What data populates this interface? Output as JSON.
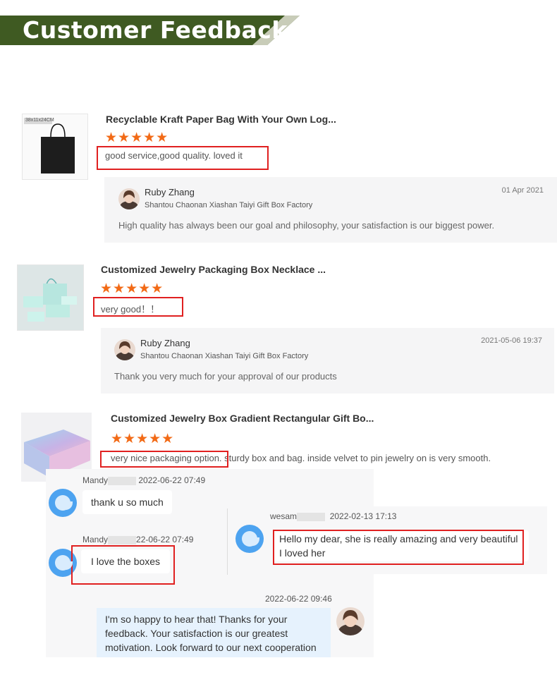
{
  "header": {
    "title": "Customer Feedback"
  },
  "reviews": [
    {
      "product_title": "Recyclable Kraft Paper Bag With Your Own Log...",
      "thumb_label": "38x11x24CM",
      "stars": "★★★★★",
      "rating": 5,
      "text": "good service,good quality. loved it",
      "reply": {
        "name": "Ruby Zhang",
        "company": "Shantou Chaonan Xiashan Taiyi Gift Box Factory",
        "date": "01 Apr 2021",
        "message": "High quality has always been our goal and philosophy, your satisfaction is our biggest power."
      }
    },
    {
      "product_title": "Customized Jewelry Packaging Box Necklace ...",
      "stars": "★★★★★",
      "rating": 5,
      "text": "very good！！",
      "reply": {
        "name": "Ruby Zhang",
        "company": "Shantou Chaonan Xiashan Taiyi Gift Box Factory",
        "date": "2021-05-06 19:37",
        "message": "Thank you very much for your approval of our products"
      }
    },
    {
      "product_title": "Customized Jewelry Box Gradient Rectangular Gift Bo...",
      "stars": "★★★★★",
      "rating": 5,
      "text_highlight": "very nice packaging option.",
      "text_rest": "sturdy box and bag. inside velvet to pin jewelry on is very smooth."
    }
  ],
  "chat_left": {
    "messages": [
      {
        "name": "Mandy",
        "date": "2022-06-22 07:49",
        "text": "thank u so much"
      },
      {
        "name": "Mandy",
        "date": "22-06-22 07:49",
        "text": "I love the boxes"
      }
    ],
    "reply": {
      "date": "2022-06-22 09:46",
      "text": "I'm so happy to hear that! Thanks for your feedback. Your satisfaction is our greatest motivation. Look forward to our next cooperation"
    }
  },
  "chat_right": {
    "name": "wesam",
    "date": "2022-02-13 17:13",
    "text": "Hello my dear, she is really amazing and very beautiful I loved her"
  },
  "colors": {
    "banner": "#3f5a22",
    "stars": "#f26a16",
    "highlight": "#e02020",
    "avatar": "#4da3f0"
  }
}
